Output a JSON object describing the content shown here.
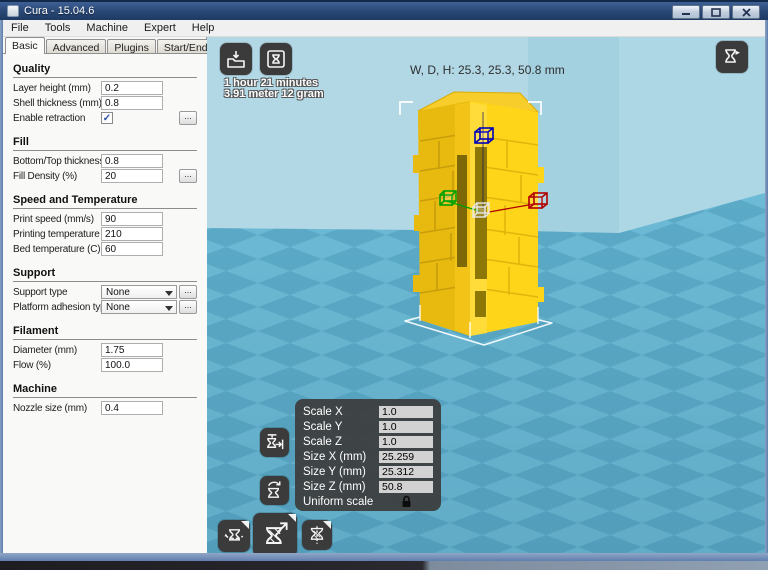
{
  "window": {
    "title": "Cura - 15.04.6"
  },
  "menu": {
    "items": [
      "File",
      "Tools",
      "Machine",
      "Expert",
      "Help"
    ]
  },
  "tabs": [
    {
      "label": "Basic",
      "selected": true
    },
    {
      "label": "Advanced",
      "selected": false
    },
    {
      "label": "Plugins",
      "selected": false
    },
    {
      "label": "Start/End-GCode",
      "selected": false
    }
  ],
  "labels": {
    "ellipsis": "...",
    "check": "✓"
  },
  "settings": {
    "sections": [
      {
        "title": "Quality",
        "rows": [
          {
            "label": "Layer height (mm)",
            "value": "0.2"
          },
          {
            "label": "Shell thickness (mm)",
            "value": "0.8"
          },
          {
            "label": "Enable retraction",
            "checked": true
          }
        ]
      },
      {
        "title": "Fill",
        "rows": [
          {
            "label": "Bottom/Top thickness (mm)",
            "value": "0.8"
          },
          {
            "label": "Fill Density (%)",
            "value": "20"
          }
        ]
      },
      {
        "title": "Speed and Temperature",
        "rows": [
          {
            "label": "Print speed (mm/s)",
            "value": "90"
          },
          {
            "label": "Printing temperature (C)",
            "value": "210"
          },
          {
            "label": "Bed temperature (C)",
            "value": "60"
          }
        ]
      },
      {
        "title": "Support",
        "rows": [
          {
            "label": "Support type",
            "value": "None"
          },
          {
            "label": "Platform adhesion type",
            "value": "None"
          }
        ]
      },
      {
        "title": "Filament",
        "rows": [
          {
            "label": "Diameter (mm)",
            "value": "1.75"
          },
          {
            "label": "Flow (%)",
            "value": "100.0"
          }
        ]
      },
      {
        "title": "Machine",
        "rows": [
          {
            "label": "Nozzle size (mm)",
            "value": "0.4"
          }
        ]
      }
    ]
  },
  "viewport": {
    "time_line1": "1 hour 21 minutes",
    "time_line2": "3.91 meter 12 gram",
    "dimensions_label": "W, D, H: 25.3, 25.3, 50.8 mm",
    "scale_panel": {
      "rows": [
        {
          "label": "Scale X",
          "value": "1.0"
        },
        {
          "label": "Scale Y",
          "value": "1.0"
        },
        {
          "label": "Scale Z",
          "value": "1.0"
        },
        {
          "label": "Size X (mm)",
          "value": "25.259"
        },
        {
          "label": "Size Y (mm)",
          "value": "25.312"
        },
        {
          "label": "Size Z (mm)",
          "value": "50.8"
        }
      ],
      "uniform_label": "Uniform scale",
      "lock_state": "locked"
    },
    "icons": {
      "load": "load-model-icon",
      "toolpath": "save-toolpath-icon",
      "view_mode": "view-mode-icon",
      "scale_max": "scale-to-max-icon",
      "reset_scale": "reset-scale-icon",
      "rotate": "rotate-icon",
      "scale": "scale-icon",
      "mirror": "mirror-icon",
      "lock": "lock-icon"
    }
  },
  "colors": {
    "model_yellow": "#ffd51a",
    "model_shadow_yellow": "#e8b90f",
    "bed_light": "#6cbad5",
    "bed_dark": "#5baac7",
    "wall_blue": "#b2d8e6",
    "axis_x_red": "#b00000",
    "axis_y_green": "#00a000",
    "axis_z_blue": "#0000b8",
    "panel_dark": "#3c3c3c",
    "titlebar_blue": "#2c4a78"
  }
}
